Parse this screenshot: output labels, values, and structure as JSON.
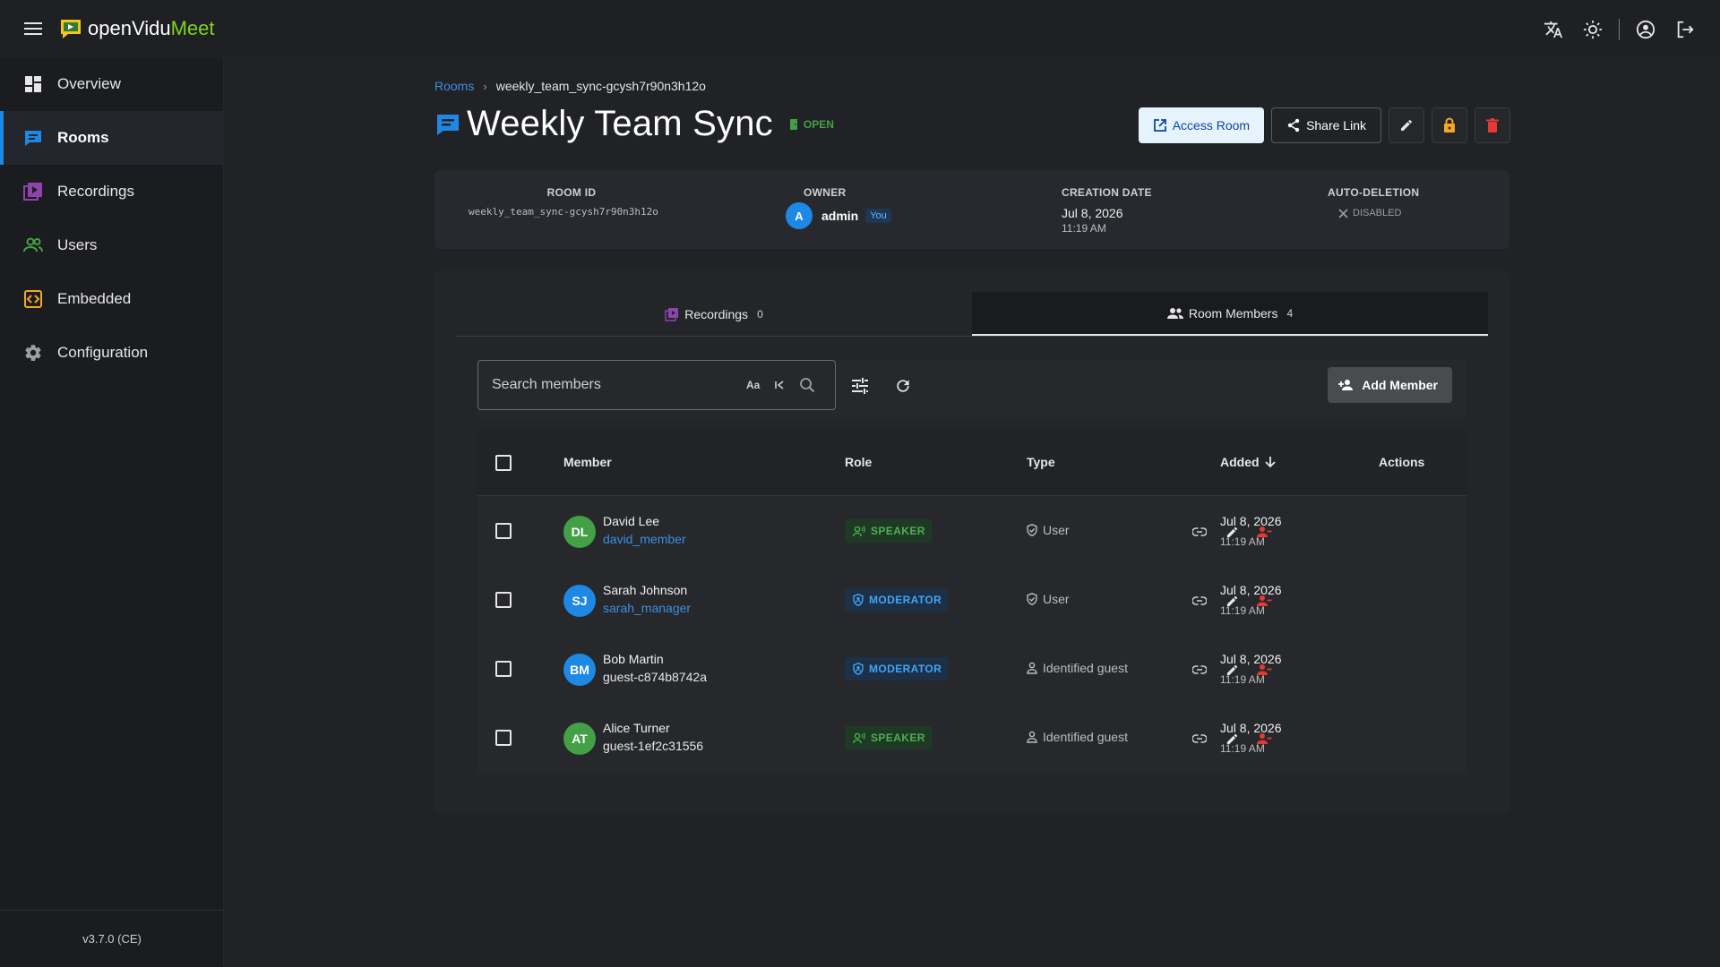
{
  "app": {
    "logo_part1": "openVidu",
    "logo_part2": "Meet",
    "version": "v3.7.0 (CE)"
  },
  "topbar_icons": [
    "menu-icon",
    "translate-icon",
    "brightness-icon",
    "account-circle-icon",
    "logout-icon"
  ],
  "sidebar": {
    "items": [
      {
        "label": "Overview",
        "icon": "dashboard-icon",
        "color": "#e6e6e6"
      },
      {
        "label": "Rooms",
        "icon": "chat-bubble-icon",
        "color": "#1e88e5"
      },
      {
        "label": "Recordings",
        "icon": "video-library-icon",
        "color": "#8e44ad"
      },
      {
        "label": "Users",
        "icon": "people-icon",
        "color": "#43a047"
      },
      {
        "label": "Embedded",
        "icon": "code-icon",
        "color": "#f5a623"
      },
      {
        "label": "Configuration",
        "icon": "settings-icon",
        "color": "#9e9e9e"
      }
    ],
    "active": "Rooms"
  },
  "breadcrumb": {
    "parent": "Rooms",
    "current": "weekly_team_sync-gcysh7r90n3h12o"
  },
  "room": {
    "title": "Weekly Team Sync",
    "status": "OPEN",
    "status_color": "#43a047"
  },
  "header_actions": {
    "access_room": "Access Room",
    "share_link": "Share Link"
  },
  "info": {
    "room_id_label": "ROOM ID",
    "room_id": "weekly_team_sync-gcysh7r90n3h12o",
    "owner_label": "OWNER",
    "owner_initial": "A",
    "owner_name": "admin",
    "owner_badge": "You",
    "creation_label": "CREATION DATE",
    "creation_date": "Jul 8, 2026",
    "creation_time": "11:19 AM",
    "auto_deletion_label": "AUTO-DELETION",
    "auto_deletion_value": "DISABLED"
  },
  "tabs": [
    {
      "label": "Recordings",
      "count": "0",
      "active": false
    },
    {
      "label": "Room Members",
      "count": "4",
      "active": true
    }
  ],
  "toolbar": {
    "search_placeholder": "Search members",
    "match_case": "Aa",
    "add_member": "Add Member"
  },
  "table": {
    "headers": {
      "member": "Member",
      "role": "Role",
      "type": "Type",
      "added": "Added",
      "actions": "Actions"
    },
    "sort": "added-descending",
    "rows": [
      {
        "initials": "DL",
        "avatar_color": "#43a047",
        "name": "David Lee",
        "username": "david_member",
        "username_color": "#3d8fe0",
        "role": "SPEAKER",
        "type": "User",
        "type_icon": "shield-check-icon",
        "date": "Jul 8, 2026",
        "time": "11:19 AM"
      },
      {
        "initials": "SJ",
        "avatar_color": "#1e88e5",
        "name": "Sarah Johnson",
        "username": "sarah_manager",
        "username_color": "#3d8fe0",
        "role": "MODERATOR",
        "type": "User",
        "type_icon": "shield-check-icon",
        "date": "Jul 8, 2026",
        "time": "11:19 AM"
      },
      {
        "initials": "BM",
        "avatar_color": "#1e88e5",
        "name": "Bob Martin",
        "username": "guest-c874b8742a",
        "username_color": "#e6e6e6",
        "role": "MODERATOR",
        "type": "Identified guest",
        "type_icon": "person-outline-icon",
        "date": "Jul 8, 2026",
        "time": "11:19 AM"
      },
      {
        "initials": "AT",
        "avatar_color": "#43a047",
        "name": "Alice Turner",
        "username": "guest-1ef2c31556",
        "username_color": "#e6e6e6",
        "role": "SPEAKER",
        "type": "Identified guest",
        "type_icon": "person-outline-icon",
        "date": "Jul 8, 2026",
        "time": "11:19 AM"
      }
    ]
  },
  "colors": {
    "speaker_bg": "#1f3a24",
    "speaker_fg": "#4caf50",
    "moderator_bg": "#1c3048",
    "moderator_fg": "#42a5f5",
    "delete": "#e53935",
    "lock": "#f5a623"
  }
}
